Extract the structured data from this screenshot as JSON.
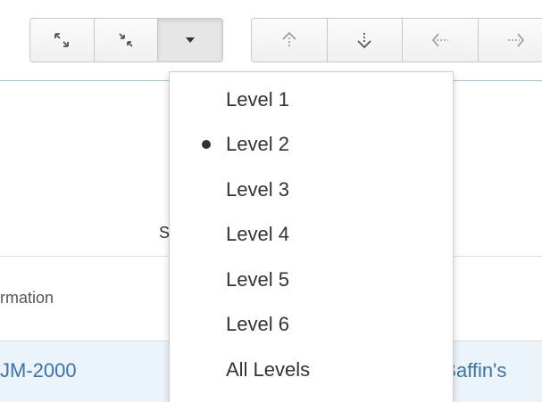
{
  "toolbar": {
    "buttons": [
      {
        "icon": "expand-icon",
        "state": "normal"
      },
      {
        "icon": "collapse-icon",
        "state": "normal"
      },
      {
        "icon": "caret-down-icon",
        "state": "active"
      }
    ],
    "nav_buttons": [
      {
        "icon": "move-up-icon"
      },
      {
        "icon": "move-down-icon"
      },
      {
        "icon": "move-left-icon"
      },
      {
        "icon": "move-right-icon"
      }
    ],
    "accent_line_color": "#8ec5e8"
  },
  "background": {
    "partial_label": "S",
    "column_header": "rmation",
    "row": {
      "key": "JM-2000",
      "summary": "' Baffin's"
    },
    "link_color": "#3b73af",
    "row_highlight": "#ebf3fb"
  },
  "level_menu": {
    "items": [
      {
        "label": "Level 1",
        "selected": false
      },
      {
        "label": "Level 2",
        "selected": true
      },
      {
        "label": "Level 3",
        "selected": false
      },
      {
        "label": "Level 4",
        "selected": false
      },
      {
        "label": "Level 5",
        "selected": false
      },
      {
        "label": "Level 6",
        "selected": false
      },
      {
        "label": "All Levels",
        "selected": false
      }
    ]
  }
}
